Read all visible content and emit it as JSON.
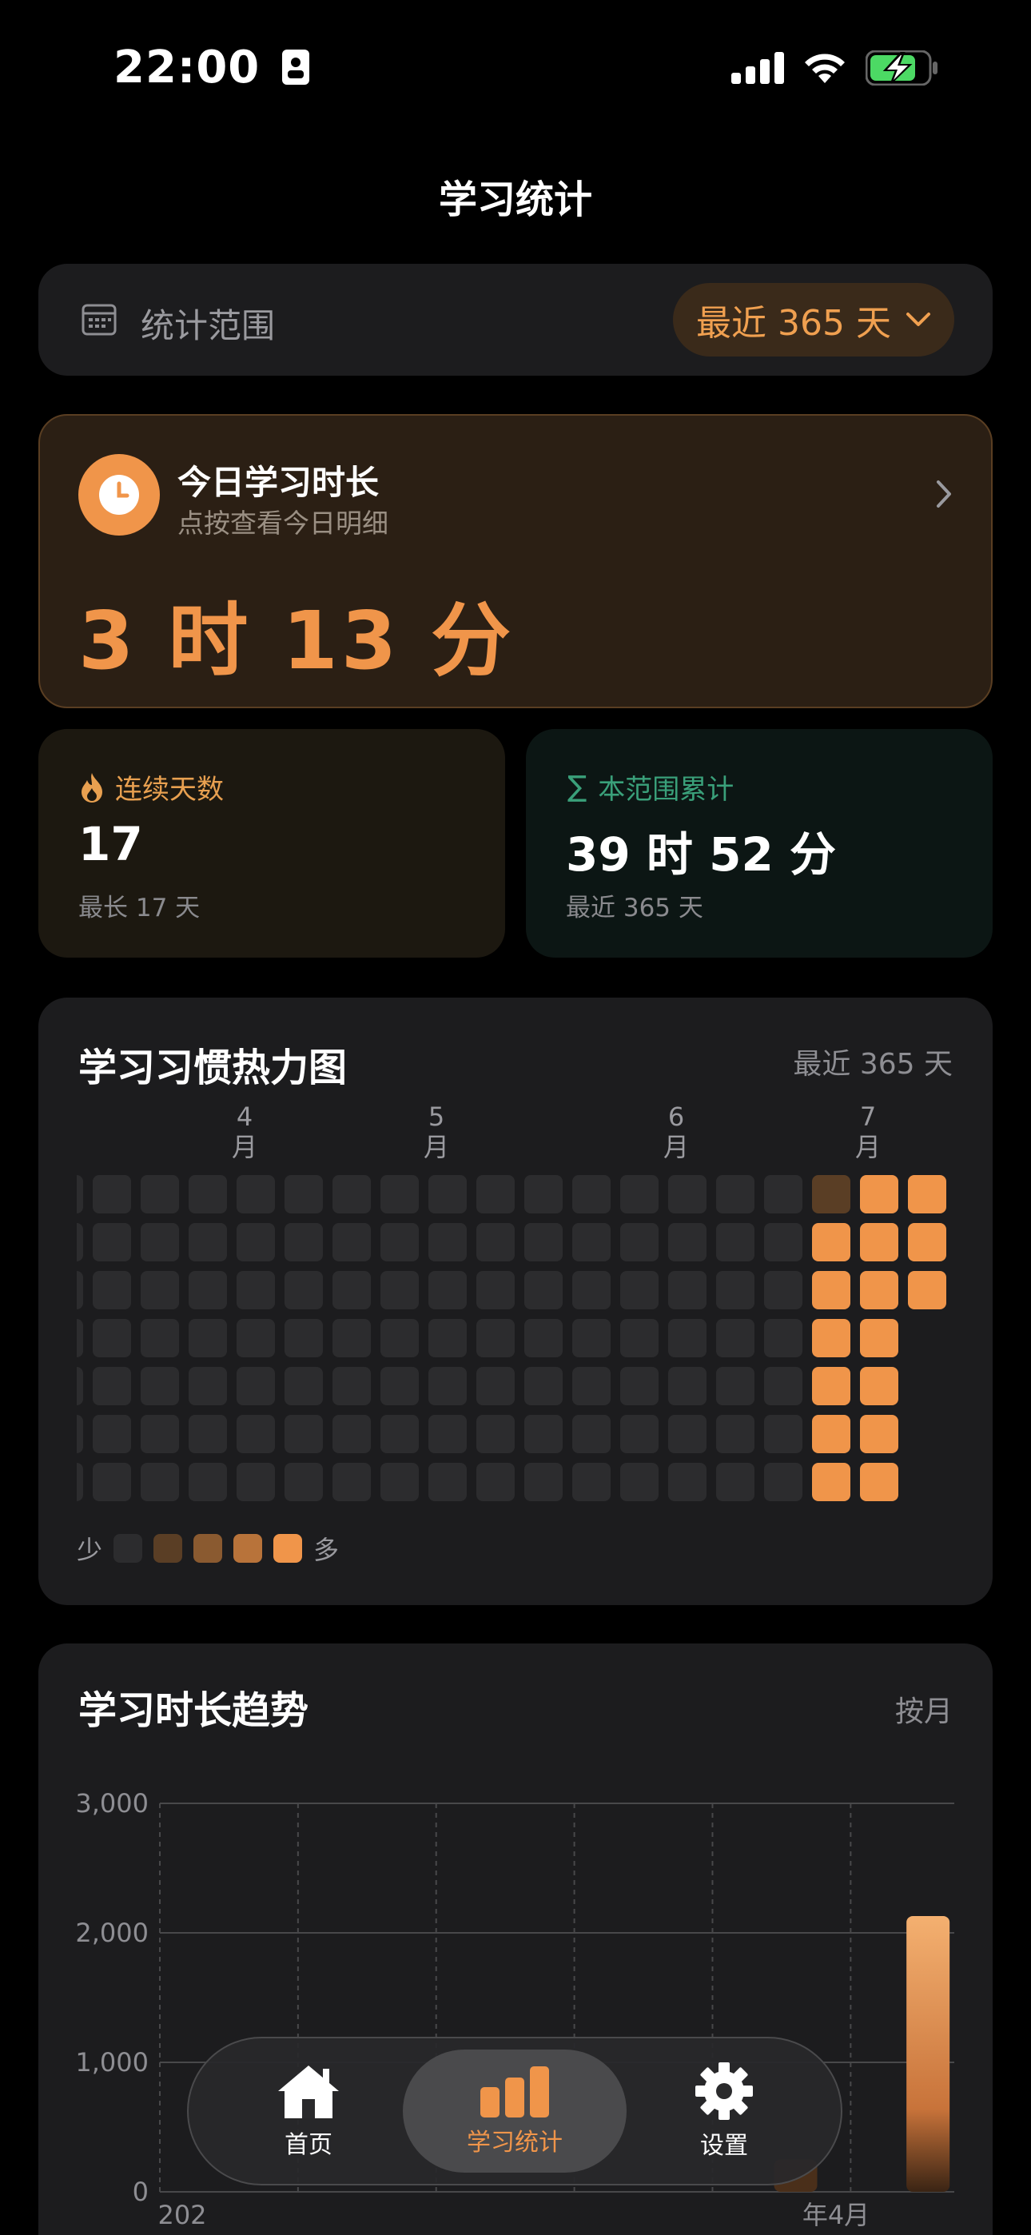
{
  "status": {
    "time": "22:00"
  },
  "page_title": "学习统计",
  "range": {
    "label": "统计范围",
    "value": "最近 365 天"
  },
  "today": {
    "title": "今日学习时长",
    "subtitle": "点按查看今日明细",
    "value": "3 时 13 分"
  },
  "streak": {
    "label": "连续天数",
    "value": "17",
    "sub": "最长 17 天",
    "accent": "#e8a050"
  },
  "total": {
    "label": "本范围累计",
    "value": "39 时 52 分",
    "sub": "最近 365 天",
    "accent": "#3aa07a"
  },
  "heatmap": {
    "title": "学习习惯热力图",
    "range": "最近 365 天",
    "months": [
      {
        "num": "4",
        "unit": "月"
      },
      {
        "num": "5",
        "unit": "月"
      },
      {
        "num": "6",
        "unit": "月"
      },
      {
        "num": "7",
        "unit": "月"
      }
    ],
    "legend_less": "少",
    "legend_more": "多",
    "colors": [
      "#2c2c2e",
      "#5a3e25",
      "#8a5a30",
      "#b8733a",
      "#f0954a"
    ],
    "active_cells": [
      {
        "col": 16,
        "row": 0,
        "level": 1
      },
      {
        "col": 17,
        "row": 0,
        "level": 4
      },
      {
        "col": 18,
        "row": 0,
        "level": 4
      },
      {
        "col": 16,
        "row": 1,
        "level": 4
      },
      {
        "col": 17,
        "row": 1,
        "level": 4
      },
      {
        "col": 18,
        "row": 1,
        "level": 4
      },
      {
        "col": 16,
        "row": 2,
        "level": 4
      },
      {
        "col": 17,
        "row": 2,
        "level": 4
      },
      {
        "col": 18,
        "row": 2,
        "level": 4
      },
      {
        "col": 16,
        "row": 3,
        "level": 4
      },
      {
        "col": 17,
        "row": 3,
        "level": 4
      },
      {
        "col": 16,
        "row": 4,
        "level": 4
      },
      {
        "col": 17,
        "row": 4,
        "level": 4
      },
      {
        "col": 16,
        "row": 5,
        "level": 4
      },
      {
        "col": 17,
        "row": 5,
        "level": 4
      },
      {
        "col": 16,
        "row": 6,
        "level": 4
      },
      {
        "col": 17,
        "row": 6,
        "level": 4
      }
    ]
  },
  "trend": {
    "title": "学习时长趋势",
    "mode": "按月",
    "x_label_left": "202",
    "x_label_right": "年4月"
  },
  "chart_data": {
    "type": "bar",
    "title": "学习时长趋势",
    "yticks": [
      "3,000",
      "2,000",
      "1,000",
      "0"
    ],
    "ylim": [
      0,
      3000
    ],
    "values": [
      0,
      0,
      0,
      0,
      250,
      2130
    ],
    "grid": true
  },
  "tabs": [
    {
      "label": "首页",
      "icon": "home-icon"
    },
    {
      "label": "学习统计",
      "icon": "bar-chart-icon",
      "active": true
    },
    {
      "label": "设置",
      "icon": "gear-icon"
    }
  ]
}
